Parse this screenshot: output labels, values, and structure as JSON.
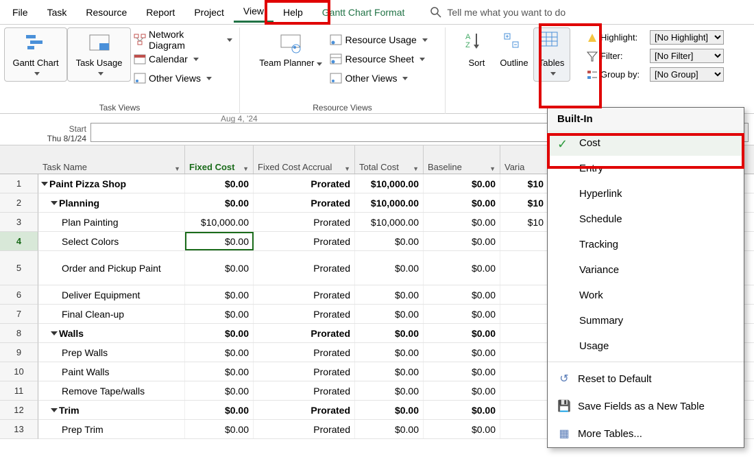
{
  "menubar": {
    "items": [
      "File",
      "Task",
      "Resource",
      "Report",
      "Project",
      "View",
      "Help",
      "Gantt Chart Format"
    ],
    "active_index": 5,
    "tell_me_placeholder": "Tell me what you want to do"
  },
  "ribbon": {
    "task_views": {
      "group_label": "Task Views",
      "gantt": "Gantt Chart",
      "task_usage": "Task Usage",
      "network_diagram": "Network Diagram",
      "calendar": "Calendar",
      "other_views": "Other Views"
    },
    "resource_views": {
      "group_label": "Resource Views",
      "team_planner": "Team Planner",
      "resource_usage": "Resource Usage",
      "resource_sheet": "Resource Sheet",
      "other_views": "Other Views"
    },
    "sort": "Sort",
    "outline": "Outline",
    "tables": "Tables",
    "highlight_label": "Highlight:",
    "filter_label": "Filter:",
    "group_label": "Group by:",
    "highlight_value": "[No Highlight]",
    "filter_value": "[No Filter]",
    "group_value": "[No Group]"
  },
  "timeline": {
    "start_label": "Start",
    "start_date": "Thu 8/1/24",
    "center_date": "Aug 4, '24"
  },
  "columns": {
    "task": "Task Name",
    "fixed_cost": "Fixed Cost",
    "accrual": "Fixed Cost Accrual",
    "total_cost": "Total Cost",
    "baseline": "Baseline",
    "variance": "Varia"
  },
  "rows": [
    {
      "n": "1",
      "task": "Paint Pizza Shop",
      "bold": true,
      "level": 0,
      "fixed": "$0.00",
      "accr": "Prorated",
      "total": "$10,000.00",
      "base": "$0.00",
      "var": "$10"
    },
    {
      "n": "2",
      "task": "Planning",
      "bold": true,
      "level": 1,
      "fixed": "$0.00",
      "accr": "Prorated",
      "total": "$10,000.00",
      "base": "$0.00",
      "var": "$10"
    },
    {
      "n": "3",
      "task": "Plan Painting",
      "bold": false,
      "level": 2,
      "fixed": "$10,000.00",
      "accr": "Prorated",
      "total": "$10,000.00",
      "base": "$0.00",
      "var": "$10"
    },
    {
      "n": "4",
      "task": "Select Colors",
      "bold": false,
      "level": 2,
      "fixed": "$0.00",
      "accr": "Prorated",
      "total": "$0.00",
      "base": "$0.00",
      "var": "",
      "selected": true
    },
    {
      "n": "5",
      "task": "Order and Pickup Paint",
      "bold": false,
      "level": 2,
      "fixed": "$0.00",
      "accr": "Prorated",
      "total": "$0.00",
      "base": "$0.00",
      "var": "",
      "tall": true
    },
    {
      "n": "6",
      "task": "Deliver Equipment",
      "bold": false,
      "level": 2,
      "fixed": "$0.00",
      "accr": "Prorated",
      "total": "$0.00",
      "base": "$0.00",
      "var": ""
    },
    {
      "n": "7",
      "task": "Final Clean-up",
      "bold": false,
      "level": 2,
      "fixed": "$0.00",
      "accr": "Prorated",
      "total": "$0.00",
      "base": "$0.00",
      "var": ""
    },
    {
      "n": "8",
      "task": "Walls",
      "bold": true,
      "level": 1,
      "fixed": "$0.00",
      "accr": "Prorated",
      "total": "$0.00",
      "base": "$0.00",
      "var": ""
    },
    {
      "n": "9",
      "task": "Prep Walls",
      "bold": false,
      "level": 2,
      "fixed": "$0.00",
      "accr": "Prorated",
      "total": "$0.00",
      "base": "$0.00",
      "var": ""
    },
    {
      "n": "10",
      "task": "Paint Walls",
      "bold": false,
      "level": 2,
      "fixed": "$0.00",
      "accr": "Prorated",
      "total": "$0.00",
      "base": "$0.00",
      "var": ""
    },
    {
      "n": "11",
      "task": "Remove Tape/walls",
      "bold": false,
      "level": 2,
      "fixed": "$0.00",
      "accr": "Prorated",
      "total": "$0.00",
      "base": "$0.00",
      "var": ""
    },
    {
      "n": "12",
      "task": "Trim",
      "bold": true,
      "level": 1,
      "fixed": "$0.00",
      "accr": "Prorated",
      "total": "$0.00",
      "base": "$0.00",
      "var": ""
    },
    {
      "n": "13",
      "task": "Prep Trim",
      "bold": false,
      "level": 2,
      "fixed": "$0.00",
      "accr": "Prorated",
      "total": "$0.00",
      "base": "$0.00",
      "var": ""
    }
  ],
  "dropdown": {
    "header": "Built-In",
    "options": [
      "Cost",
      "Entry",
      "Hyperlink",
      "Schedule",
      "Tracking",
      "Variance",
      "Work",
      "Summary",
      "Usage"
    ],
    "selected_index": 0,
    "reset": "Reset to Default",
    "save": "Save Fields as a New Table",
    "more": "More Tables..."
  }
}
